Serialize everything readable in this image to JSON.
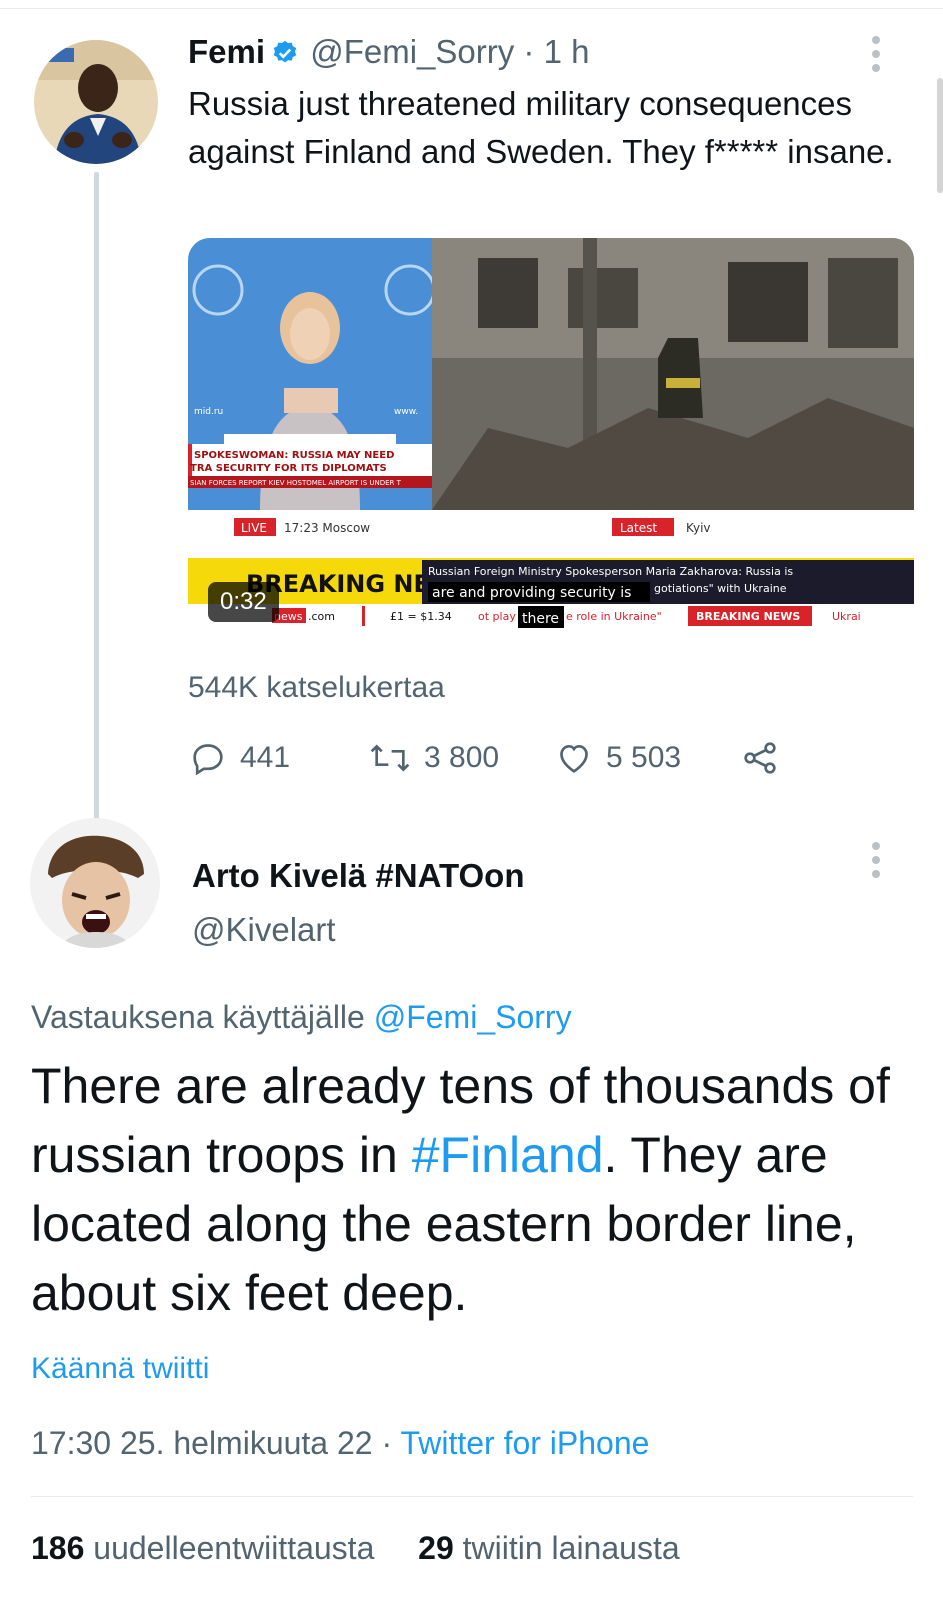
{
  "tweet1": {
    "name": "Femi",
    "handle": "@Femi_Sorry",
    "separator": "·",
    "time": "1 h",
    "text": "Russia just threatened military consequences against Finland and Sweden. They f***** insane.",
    "video": {
      "duration": "0:32",
      "left_banner_line1": "SPOKESWOMAN: RUSSIA MAY NEED",
      "left_banner_line2": "TRA SECURITY FOR ITS DIPLOMATS",
      "left_ticker": "SIAN FORCES REPORT KIEV HOSTOMEL AIRPORT IS UNDER T",
      "wall_left": "mid.ru",
      "wall_right": "www.",
      "live_badge": "LIVE",
      "live_time": "17:23 Moscow",
      "latest_badge": "Latest",
      "latest_place": "Kyiv",
      "breaking": "BREAKING NEWS",
      "headline_line1": "Russian Foreign Ministry Spokesperson Maria Zakharova: Russia is",
      "headline_line2": "gotiations\" with Ukraine",
      "subtitle_1": "are and providing security is",
      "subtitle_2": "there",
      "ticker_brand": "news",
      "ticker_com": ".com",
      "ticker_fx": "£1 = $1.34",
      "ticker_text": "ot play",
      "ticker_text2": "e role in Ukraine\"",
      "ticker_breaking": "BREAKING NEWS",
      "ticker_end": "Ukrai"
    },
    "views": "544K katselukertaa",
    "replies": "441",
    "retweets": "3 800",
    "likes": "5 503"
  },
  "tweet2": {
    "name": "Arto Kivelä #NATOon",
    "handle": "@Kivelart",
    "reply_prefix": "Vastauksena käyttäjälle",
    "reply_handle": "@Femi_Sorry",
    "text_before": "There are already tens of thousands of russian troops in ",
    "hashtag": "#Finland",
    "text_after": ". They are located along the eastern border line, about six feet deep.",
    "translate": "Käännä twiitti",
    "timestamp": "17:30 25. helmikuuta 22",
    "meta_sep": " · ",
    "client": "Twitter for iPhone",
    "retweet_count": "186",
    "retweet_label": "uudelleentwiittausta",
    "quote_count": "29",
    "quote_label": "twiitin lainausta"
  },
  "colors": {
    "link": "#1d9bf0",
    "muted": "#536471",
    "text": "#0f1419",
    "sky_yellow": "#f5d90a",
    "sky_red": "#d8232a"
  }
}
